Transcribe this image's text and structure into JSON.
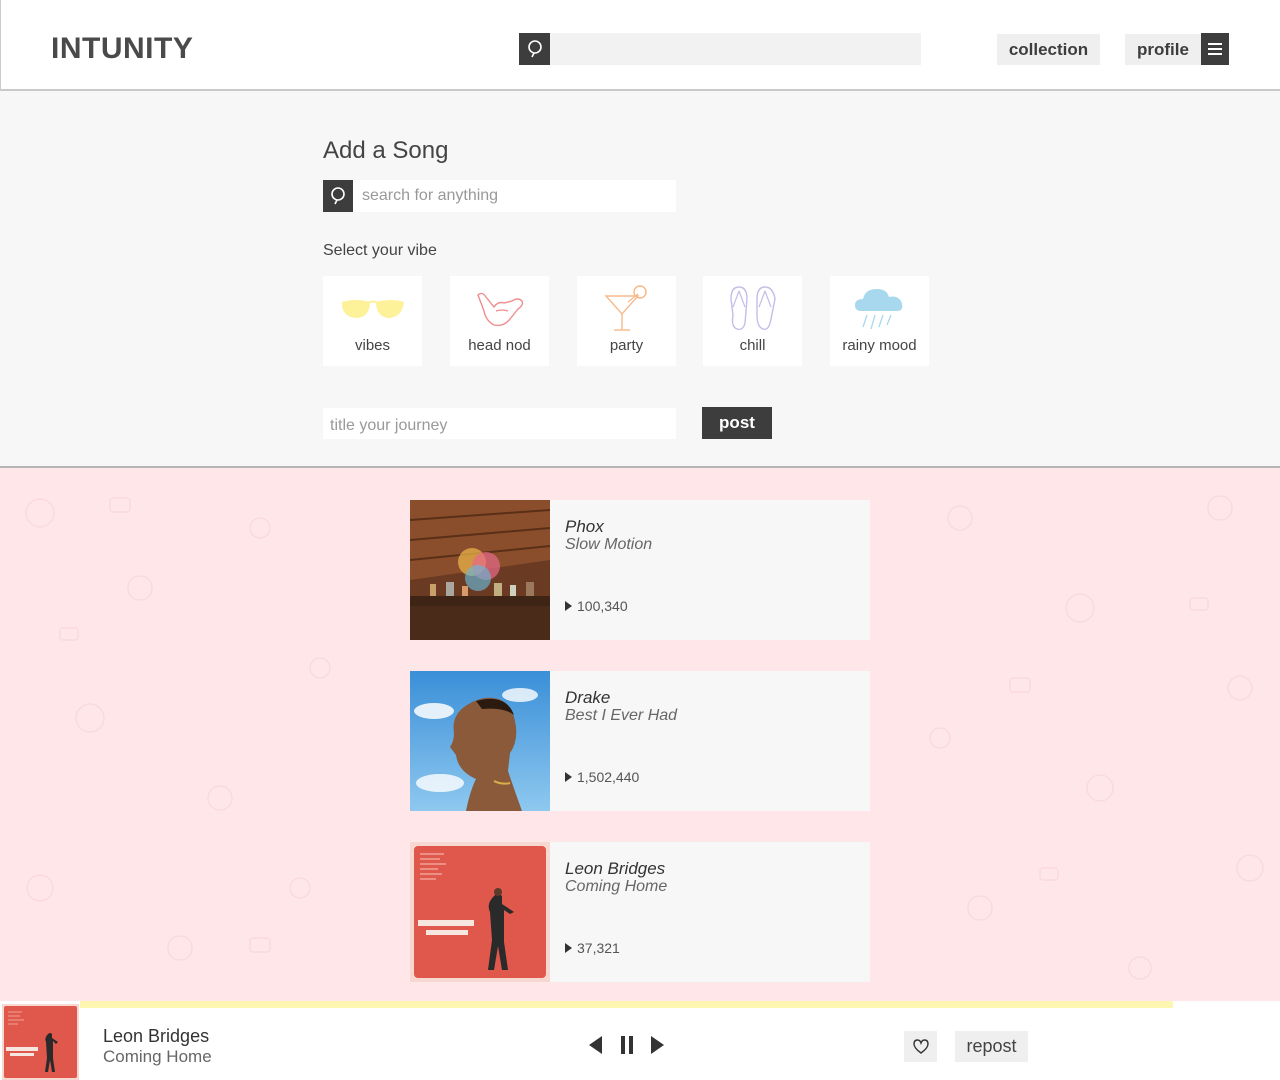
{
  "header": {
    "logo": "INTUNITY",
    "search_placeholder": "",
    "collection_label": "collection",
    "profile_label": "profile"
  },
  "add_song": {
    "title": "Add a Song",
    "search_placeholder": "search for anything",
    "vibe_label": "Select your vibe",
    "vibes": [
      {
        "label": "vibes",
        "icon": "sunglasses-icon",
        "color": "#fdf29a"
      },
      {
        "label": "head nod",
        "icon": "shaka-hand-icon",
        "color": "#f08c8c"
      },
      {
        "label": "party",
        "icon": "cocktail-icon",
        "color": "#f5b98a"
      },
      {
        "label": "chill",
        "icon": "flip-flops-icon",
        "color": "#c3bde8"
      },
      {
        "label": "rainy mood",
        "icon": "rain-cloud-icon",
        "color": "#a8d8ee"
      }
    ],
    "journey_placeholder": "title your journey",
    "post_label": "post"
  },
  "feed": [
    {
      "artist": "Phox",
      "song": "Slow Motion",
      "plays": "100,340",
      "art": "phox-album-art"
    },
    {
      "artist": "Drake",
      "song": "Best I Ever Had",
      "plays": "1,502,440",
      "art": "drake-album-art"
    },
    {
      "artist": "Leon Bridges",
      "song": "Coming Home",
      "plays": "37,321",
      "art": "leon-bridges-album-art"
    }
  ],
  "player": {
    "artist": "Leon Bridges",
    "song": "Coming Home",
    "repost_label": "repost",
    "progress": 1.0,
    "progress_color": "#fdf6b0"
  },
  "colors": {
    "dark": "#3d3d3d",
    "feed_bg": "#fee6e9",
    "section_bg": "#f7f7f7"
  }
}
